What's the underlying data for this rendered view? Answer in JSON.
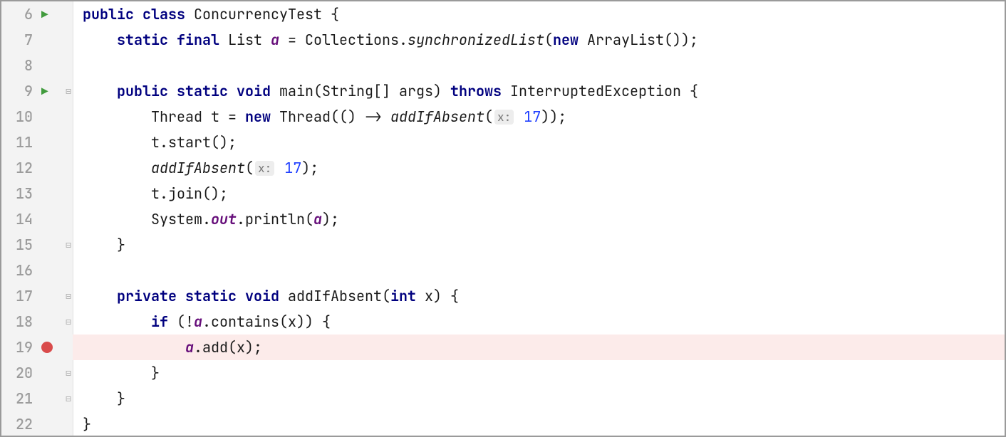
{
  "tokens": {
    "kw_public": "public",
    "kw_class": "class",
    "kw_static": "static",
    "kw_final": "final",
    "kw_void": "void",
    "kw_throws": "throws",
    "kw_new": "new",
    "kw_private": "private",
    "kw_if": "if",
    "kw_int": "int"
  },
  "idents": {
    "ConcurrencyTest": "ConcurrencyTest",
    "List": "List",
    "a": "a",
    "Collections": "Collections",
    "synchronizedList": "synchronizedList",
    "ArrayList": "ArrayList",
    "main": "main",
    "String": "String",
    "args": "args",
    "InterruptedException": "InterruptedException",
    "Thread": "Thread",
    "t": "t",
    "addIfAbsent": "addIfAbsent",
    "start": "start",
    "join": "join",
    "System": "System",
    "out": "out",
    "println": "println",
    "contains": "contains",
    "add": "add",
    "x": "x"
  },
  "hints": {
    "x_hint": "x:"
  },
  "nums": {
    "seventeen": "17"
  },
  "punct": {
    "sp": " ",
    "sp2": "  ",
    "sp4": "    ",
    "sp8": "        ",
    "sp12": "            ",
    "sp16": "                ",
    "ob": "{",
    "cb": "}",
    "op": "(",
    "cp": ")",
    "eq": " = ",
    "semi": ";",
    "dot": ".",
    "comma": ", ",
    "brackets": "[]",
    "bang": "!",
    "arrow": " -> "
  },
  "lines": {
    "6": "6",
    "7": "7",
    "8": "8",
    "9": "9",
    "10": "10",
    "11": "11",
    "12": "12",
    "13": "13",
    "14": "14",
    "15": "15",
    "16": "16",
    "17": "17",
    "18": "18",
    "19": "19",
    "20": "20",
    "21": "21",
    "22": "22"
  },
  "gutter_icons": {
    "run": "▶"
  }
}
